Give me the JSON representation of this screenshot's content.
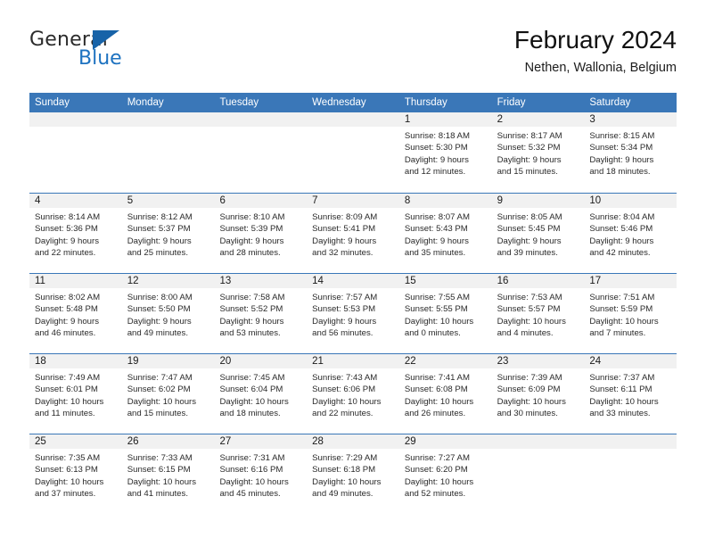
{
  "logo": {
    "word_one": "General",
    "word_two": "Blue",
    "triangle_color": "#1763a8",
    "blue_text_color": "#1d72c0",
    "icon": "triangle-icon"
  },
  "header": {
    "title": "February 2024",
    "location": "Nethen, Wallonia, Belgium"
  },
  "theme": {
    "header_blue": "#3a77b8",
    "date_strip_gray": "#f1f1f1",
    "text_color": "#2a2a2a"
  },
  "weekdays": [
    "Sunday",
    "Monday",
    "Tuesday",
    "Wednesday",
    "Thursday",
    "Friday",
    "Saturday"
  ],
  "weeks": [
    [
      {
        "day": "",
        "lines": []
      },
      {
        "day": "",
        "lines": []
      },
      {
        "day": "",
        "lines": []
      },
      {
        "day": "",
        "lines": []
      },
      {
        "day": "1",
        "lines": [
          "Sunrise: 8:18 AM",
          "Sunset: 5:30 PM",
          "Daylight: 9 hours",
          "and 12 minutes."
        ]
      },
      {
        "day": "2",
        "lines": [
          "Sunrise: 8:17 AM",
          "Sunset: 5:32 PM",
          "Daylight: 9 hours",
          "and 15 minutes."
        ]
      },
      {
        "day": "3",
        "lines": [
          "Sunrise: 8:15 AM",
          "Sunset: 5:34 PM",
          "Daylight: 9 hours",
          "and 18 minutes."
        ]
      }
    ],
    [
      {
        "day": "4",
        "lines": [
          "Sunrise: 8:14 AM",
          "Sunset: 5:36 PM",
          "Daylight: 9 hours",
          "and 22 minutes."
        ]
      },
      {
        "day": "5",
        "lines": [
          "Sunrise: 8:12 AM",
          "Sunset: 5:37 PM",
          "Daylight: 9 hours",
          "and 25 minutes."
        ]
      },
      {
        "day": "6",
        "lines": [
          "Sunrise: 8:10 AM",
          "Sunset: 5:39 PM",
          "Daylight: 9 hours",
          "and 28 minutes."
        ]
      },
      {
        "day": "7",
        "lines": [
          "Sunrise: 8:09 AM",
          "Sunset: 5:41 PM",
          "Daylight: 9 hours",
          "and 32 minutes."
        ]
      },
      {
        "day": "8",
        "lines": [
          "Sunrise: 8:07 AM",
          "Sunset: 5:43 PM",
          "Daylight: 9 hours",
          "and 35 minutes."
        ]
      },
      {
        "day": "9",
        "lines": [
          "Sunrise: 8:05 AM",
          "Sunset: 5:45 PM",
          "Daylight: 9 hours",
          "and 39 minutes."
        ]
      },
      {
        "day": "10",
        "lines": [
          "Sunrise: 8:04 AM",
          "Sunset: 5:46 PM",
          "Daylight: 9 hours",
          "and 42 minutes."
        ]
      }
    ],
    [
      {
        "day": "11",
        "lines": [
          "Sunrise: 8:02 AM",
          "Sunset: 5:48 PM",
          "Daylight: 9 hours",
          "and 46 minutes."
        ]
      },
      {
        "day": "12",
        "lines": [
          "Sunrise: 8:00 AM",
          "Sunset: 5:50 PM",
          "Daylight: 9 hours",
          "and 49 minutes."
        ]
      },
      {
        "day": "13",
        "lines": [
          "Sunrise: 7:58 AM",
          "Sunset: 5:52 PM",
          "Daylight: 9 hours",
          "and 53 minutes."
        ]
      },
      {
        "day": "14",
        "lines": [
          "Sunrise: 7:57 AM",
          "Sunset: 5:53 PM",
          "Daylight: 9 hours",
          "and 56 minutes."
        ]
      },
      {
        "day": "15",
        "lines": [
          "Sunrise: 7:55 AM",
          "Sunset: 5:55 PM",
          "Daylight: 10 hours",
          "and 0 minutes."
        ]
      },
      {
        "day": "16",
        "lines": [
          "Sunrise: 7:53 AM",
          "Sunset: 5:57 PM",
          "Daylight: 10 hours",
          "and 4 minutes."
        ]
      },
      {
        "day": "17",
        "lines": [
          "Sunrise: 7:51 AM",
          "Sunset: 5:59 PM",
          "Daylight: 10 hours",
          "and 7 minutes."
        ]
      }
    ],
    [
      {
        "day": "18",
        "lines": [
          "Sunrise: 7:49 AM",
          "Sunset: 6:01 PM",
          "Daylight: 10 hours",
          "and 11 minutes."
        ]
      },
      {
        "day": "19",
        "lines": [
          "Sunrise: 7:47 AM",
          "Sunset: 6:02 PM",
          "Daylight: 10 hours",
          "and 15 minutes."
        ]
      },
      {
        "day": "20",
        "lines": [
          "Sunrise: 7:45 AM",
          "Sunset: 6:04 PM",
          "Daylight: 10 hours",
          "and 18 minutes."
        ]
      },
      {
        "day": "21",
        "lines": [
          "Sunrise: 7:43 AM",
          "Sunset: 6:06 PM",
          "Daylight: 10 hours",
          "and 22 minutes."
        ]
      },
      {
        "day": "22",
        "lines": [
          "Sunrise: 7:41 AM",
          "Sunset: 6:08 PM",
          "Daylight: 10 hours",
          "and 26 minutes."
        ]
      },
      {
        "day": "23",
        "lines": [
          "Sunrise: 7:39 AM",
          "Sunset: 6:09 PM",
          "Daylight: 10 hours",
          "and 30 minutes."
        ]
      },
      {
        "day": "24",
        "lines": [
          "Sunrise: 7:37 AM",
          "Sunset: 6:11 PM",
          "Daylight: 10 hours",
          "and 33 minutes."
        ]
      }
    ],
    [
      {
        "day": "25",
        "lines": [
          "Sunrise: 7:35 AM",
          "Sunset: 6:13 PM",
          "Daylight: 10 hours",
          "and 37 minutes."
        ]
      },
      {
        "day": "26",
        "lines": [
          "Sunrise: 7:33 AM",
          "Sunset: 6:15 PM",
          "Daylight: 10 hours",
          "and 41 minutes."
        ]
      },
      {
        "day": "27",
        "lines": [
          "Sunrise: 7:31 AM",
          "Sunset: 6:16 PM",
          "Daylight: 10 hours",
          "and 45 minutes."
        ]
      },
      {
        "day": "28",
        "lines": [
          "Sunrise: 7:29 AM",
          "Sunset: 6:18 PM",
          "Daylight: 10 hours",
          "and 49 minutes."
        ]
      },
      {
        "day": "29",
        "lines": [
          "Sunrise: 7:27 AM",
          "Sunset: 6:20 PM",
          "Daylight: 10 hours",
          "and 52 minutes."
        ]
      },
      {
        "day": "",
        "lines": []
      },
      {
        "day": "",
        "lines": []
      }
    ]
  ]
}
